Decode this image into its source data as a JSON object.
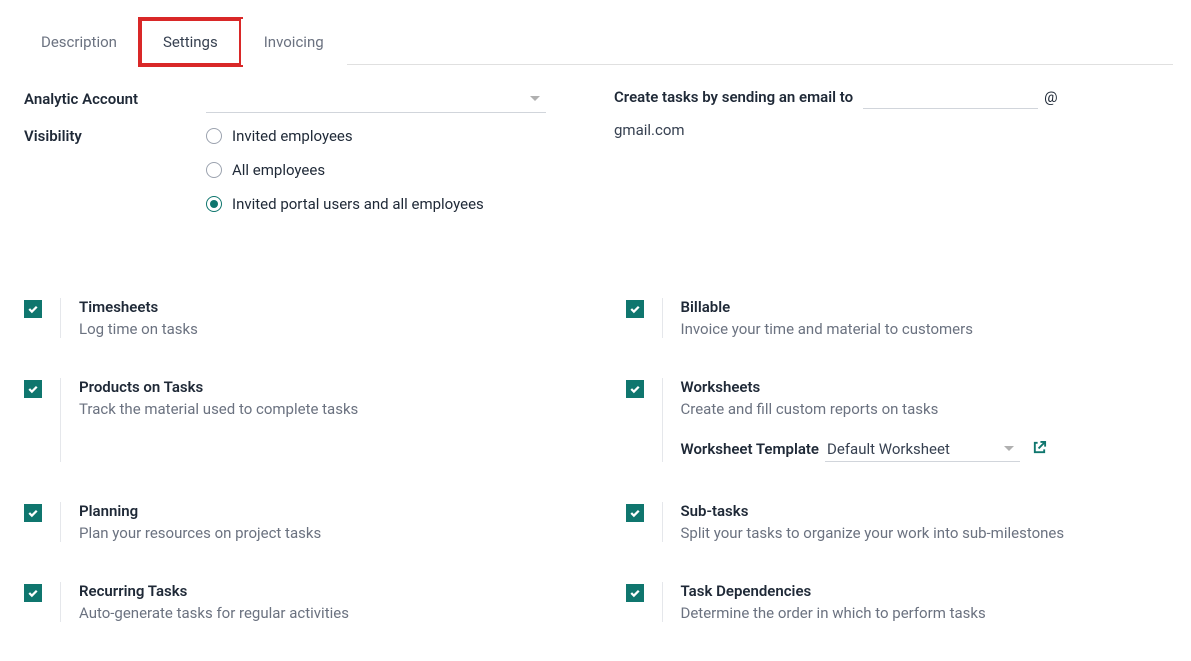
{
  "tabs": {
    "description": "Description",
    "settings": "Settings",
    "invoicing": "Invoicing"
  },
  "fields": {
    "analytic_account_label": "Analytic Account",
    "visibility_label": "Visibility"
  },
  "visibility_options": {
    "invited": "Invited employees",
    "all": "All employees",
    "portal": "Invited portal users and all employees"
  },
  "email": {
    "label": "Create tasks by sending an email to",
    "at": "@",
    "domain": "gmail.com"
  },
  "features": {
    "timesheets": {
      "title": "Timesheets",
      "desc": "Log time on tasks"
    },
    "billable": {
      "title": "Billable",
      "desc": "Invoice your time and material to customers"
    },
    "products_on_tasks": {
      "title": "Products on Tasks",
      "desc": "Track the material used to complete tasks"
    },
    "worksheets": {
      "title": "Worksheets",
      "desc": "Create and fill custom reports on tasks",
      "template_label": "Worksheet Template",
      "template_value": "Default Worksheet"
    },
    "planning": {
      "title": "Planning",
      "desc": "Plan your resources on project tasks"
    },
    "subtasks": {
      "title": "Sub-tasks",
      "desc": "Split your tasks to organize your work into sub-milestones"
    },
    "recurring": {
      "title": "Recurring Tasks",
      "desc": "Auto-generate tasks for regular activities"
    },
    "dependencies": {
      "title": "Task Dependencies",
      "desc": "Determine the order in which to perform tasks"
    }
  }
}
